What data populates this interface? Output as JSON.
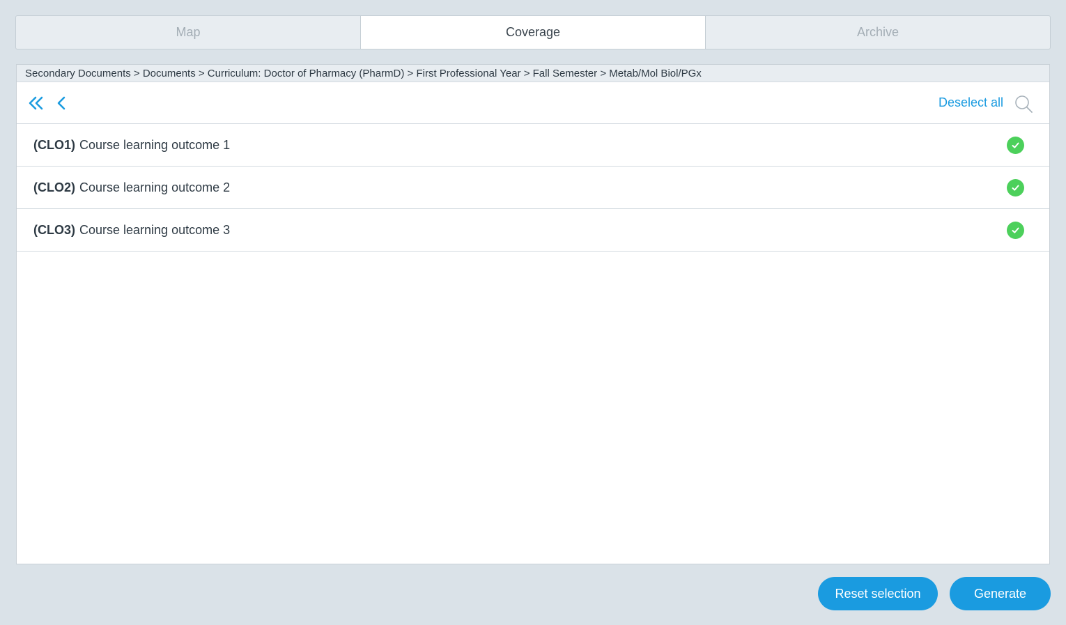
{
  "tabs": [
    {
      "label": "Map",
      "active": false
    },
    {
      "label": "Coverage",
      "active": true
    },
    {
      "label": "Archive",
      "active": false
    }
  ],
  "breadcrumb": "Secondary Documents > Documents > Curriculum: Doctor of Pharmacy (PharmD) > First Professional Year > Fall Semester > Metab/Mol Biol/PGx",
  "toolbar": {
    "first_icon": "double-chevron-left-icon",
    "prev_icon": "chevron-left-icon",
    "deselect_label": "Deselect all",
    "search_icon": "search-icon"
  },
  "outcomes": [
    {
      "code": "(CLO1)",
      "label": "Course learning outcome 1",
      "selected": true
    },
    {
      "code": "(CLO2)",
      "label": "Course learning outcome 2",
      "selected": true
    },
    {
      "code": "(CLO3)",
      "label": "Course learning outcome 3",
      "selected": true
    }
  ],
  "buttons": {
    "reset_label": "Reset selection",
    "generate_label": "Generate"
  },
  "colors": {
    "accent": "#1a9be0",
    "check": "#4cd05b",
    "background": "#dae2e8"
  }
}
